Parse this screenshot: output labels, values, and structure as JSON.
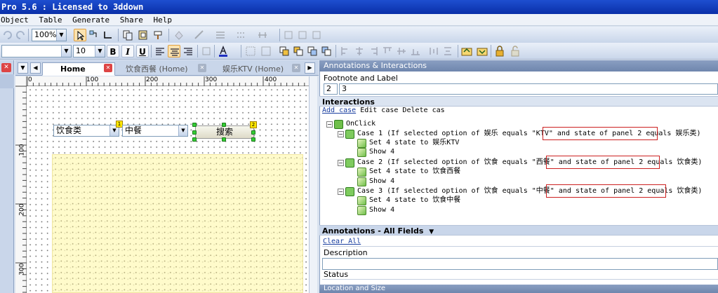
{
  "window": {
    "title": "Pro 5.6 : Licensed to 3ddown"
  },
  "menu": {
    "items": [
      "Object",
      "Table",
      "Generate",
      "Share",
      "Help"
    ]
  },
  "toolbar": {
    "zoom_value": "100%",
    "font_size_value": "10",
    "bold": "B",
    "italic": "I",
    "underline": "U"
  },
  "tabs": [
    {
      "label": "Home",
      "active": true
    },
    {
      "label": "饮食西餐 (Home)",
      "active": false
    },
    {
      "label": "娱乐KTV (Home)",
      "active": false
    }
  ],
  "ruler": {
    "top_ticks": [
      "0",
      "100",
      "200",
      "300",
      "400"
    ],
    "left_ticks": [
      "100",
      "200",
      "300"
    ]
  },
  "canvas": {
    "dropdown1_value": "饮食类",
    "dropdown2_value": "中餐",
    "search_button_label": "搜索",
    "footnote1": "1",
    "footnote2": "2"
  },
  "annotations_panel": {
    "header": "Annotations & Interactions",
    "footnote_label_title": "Footnote and Label",
    "footnote_value": "2",
    "label_value": "3",
    "interactions_title": "Interactions",
    "add_case": "Add case",
    "edit_case": "Edit case",
    "delete_case": "Delete cas",
    "event": "OnClick",
    "cases": [
      {
        "prefix": "Case 1 (If selected option of 娱乐 equals \"KTV\" and ",
        "condition": "state of panel 2 equals 娱乐类)",
        "actions": [
          "Set 4 state to 娱乐KTV",
          "Show 4"
        ]
      },
      {
        "prefix": "Case 2 (If selected option of 饮食 equals \"西餐\" and ",
        "condition": "state of panel 2 equals 饮食类)",
        "actions": [
          "Set 4 state to 饮食西餐",
          "Show 4"
        ]
      },
      {
        "prefix": "Case 3 (If selected option of 饮食 equals \"中餐\" and ",
        "condition": "state of panel 2 equals 饮食类)",
        "actions": [
          "Set 4 state to 饮食中餐",
          "Show 4"
        ]
      }
    ],
    "fields_title": "Annotations - All Fields",
    "clear_all": "Clear All",
    "description_label": "Description",
    "status_label": "Status",
    "location_header": "Location and Size"
  }
}
